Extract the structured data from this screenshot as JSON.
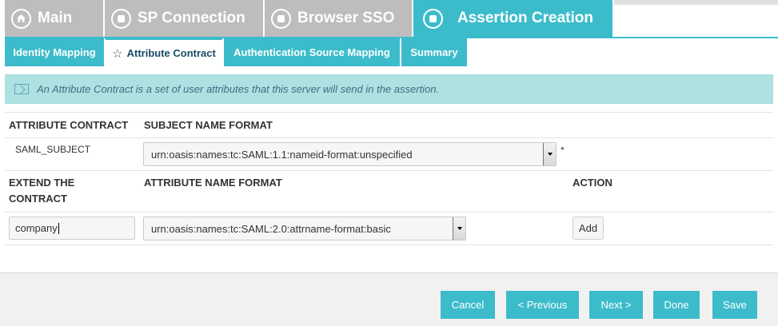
{
  "top_tabs": [
    {
      "label": "Main",
      "icon": "home-icon",
      "active": false
    },
    {
      "label": "SP Connection",
      "icon": "step-icon",
      "active": false
    },
    {
      "label": "Browser SSO",
      "icon": "step-icon",
      "active": false
    },
    {
      "label": "Assertion Creation",
      "icon": "step-icon",
      "active": true
    }
  ],
  "sub_tabs": [
    {
      "label": "Identity Mapping",
      "active": false
    },
    {
      "label": "Attribute Contract",
      "active": true,
      "icon": "star-icon"
    },
    {
      "label": "Authentication Source Mapping",
      "active": false
    },
    {
      "label": "Summary",
      "active": false
    }
  ],
  "info": {
    "text": "An Attribute Contract is a set of user attributes that this server will send in the assertion."
  },
  "contract_table": {
    "col1_header": "ATTRIBUTE CONTRACT",
    "col2_header": "SUBJECT NAME FORMAT",
    "row": {
      "attribute": "SAML_SUBJECT",
      "format": "urn:oasis:names:tc:SAML:1.1:nameid-format:unspecified",
      "required_marker": "*"
    }
  },
  "extend_table": {
    "col1_header_line1": "EXTEND THE",
    "col1_header_line2": "CONTRACT",
    "col2_header": "ATTRIBUTE NAME FORMAT",
    "col3_header": "ACTION",
    "row": {
      "input_value": "company",
      "format": "urn:oasis:names:tc:SAML:2.0:attrname-format:basic",
      "action_label": "Add"
    }
  },
  "footer": {
    "cancel": "Cancel",
    "previous": "< Previous",
    "next": "Next >",
    "done": "Done",
    "save": "Save"
  },
  "colors": {
    "accent": "#3cbccb",
    "inactive_tab": "#bdbdbd",
    "info_bg": "#ade1e2",
    "info_text": "#3d6f82"
  }
}
